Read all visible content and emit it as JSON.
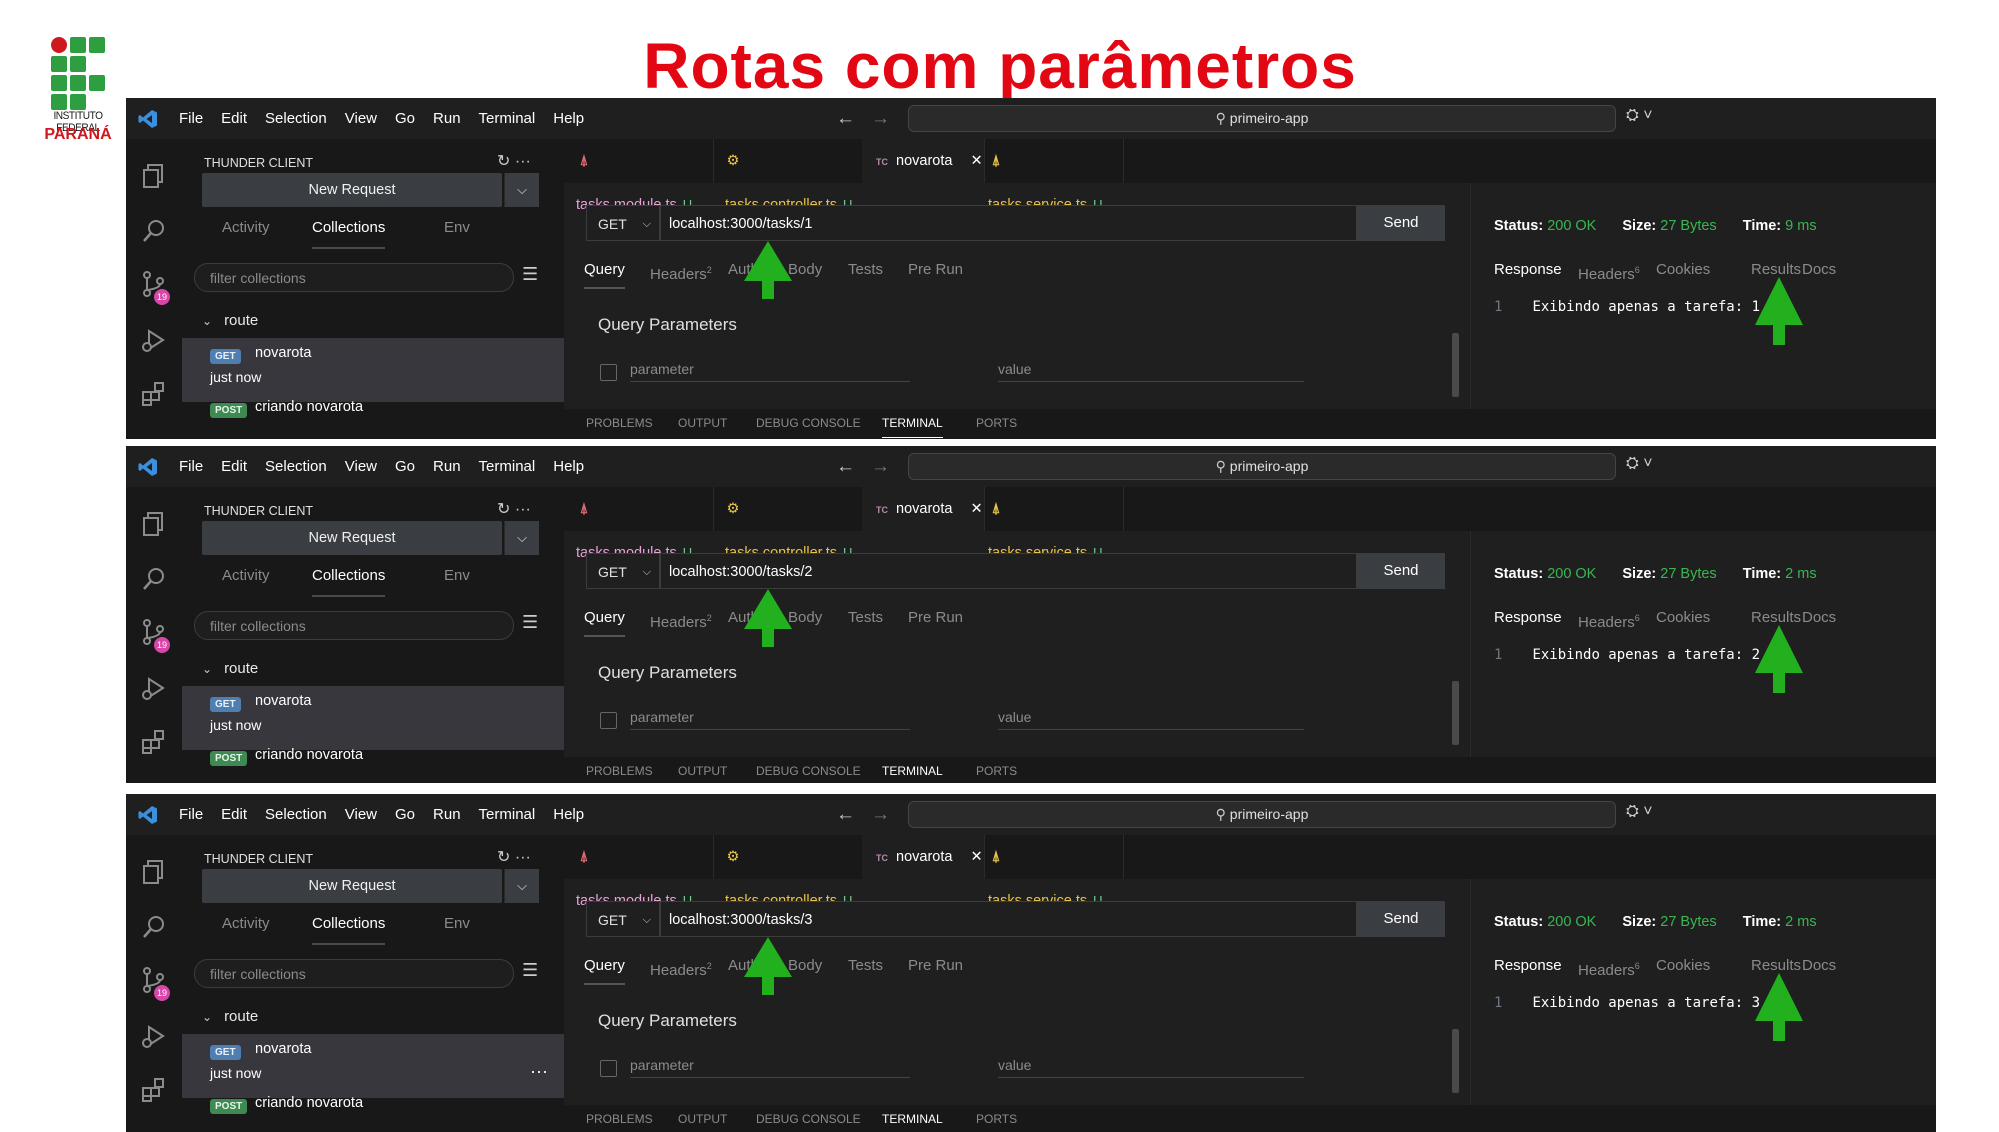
{
  "logo": {
    "line1": "INSTITUTO FEDERAL",
    "line2": "PARANÁ"
  },
  "slide_title": "Rotas com parâmetros",
  "menu": [
    "File",
    "Edit",
    "Selection",
    "View",
    "Go",
    "Run",
    "Terminal",
    "Help"
  ],
  "command_search": "primeiro-app",
  "sidebar": {
    "title": "THUNDER CLIENT",
    "new_request": "New Request",
    "tabs": [
      "Activity",
      "Collections",
      "Env"
    ],
    "filter_placeholder": "filter collections",
    "folder": "route",
    "request": {
      "method": "GET",
      "name": "novarota",
      "time": "just now"
    },
    "request2": {
      "method": "POST",
      "name": "criando novarota"
    }
  },
  "editor_tabs": [
    {
      "label": "tasks.module.ts",
      "modified": "U",
      "icon": "angular-icon",
      "color": "#e8a0d9"
    },
    {
      "label": "tasks.controller.ts",
      "modified": "U",
      "icon": "gear-icon",
      "color": "#e8c34a"
    },
    {
      "label": "novarota",
      "icon_text": "TC",
      "icon": "thunder-client-icon"
    },
    {
      "label": "tasks.service.ts",
      "modified": "U",
      "icon": "angular-service-icon",
      "color": "#e8c34a"
    }
  ],
  "request_tabs": [
    {
      "label": "Query"
    },
    {
      "label": "Headers",
      "count": "2"
    },
    {
      "label": "Auth"
    },
    {
      "label": "Body"
    },
    {
      "label": "Tests"
    },
    {
      "label": "Pre Run"
    }
  ],
  "query_params": {
    "title": "Query Parameters",
    "param_placeholder": "parameter",
    "value_placeholder": "value"
  },
  "send_label": "Send",
  "response_tabs": [
    {
      "label": "Response"
    },
    {
      "label": "Headers",
      "count": "6"
    },
    {
      "label": "Cookies"
    },
    {
      "label": "Results"
    },
    {
      "label": "Docs"
    }
  ],
  "status_labels": {
    "status": "Status:",
    "size": "Size:",
    "time": "Time:"
  },
  "terminal_tabs": [
    "PROBLEMS",
    "OUTPUT",
    "DEBUG CONSOLE",
    "TERMINAL",
    "PORTS"
  ],
  "shots": [
    {
      "method": "GET",
      "url": "localhost:3000/tasks/1",
      "status": "200 OK",
      "size": "27 Bytes",
      "time": "9 ms",
      "line_number": "1",
      "response_body": "Exibindo apenas a tarefa: 1",
      "show_dots": false
    },
    {
      "method": "GET",
      "url": "localhost:3000/tasks/2",
      "status": "200 OK",
      "size": "27 Bytes",
      "time": "2 ms",
      "line_number": "1",
      "response_body": "Exibindo apenas a tarefa: 2",
      "show_dots": false
    },
    {
      "method": "GET",
      "url": "localhost:3000/tasks/3",
      "status": "200 OK",
      "size": "27 Bytes",
      "time": "2 ms",
      "line_number": "1",
      "response_body": "Exibindo apenas a tarefa: 3",
      "show_dots": true
    }
  ],
  "colors": {
    "title_red": "#e30613",
    "ok_green": "#3bb552",
    "arrow_green": "#22b01e"
  }
}
